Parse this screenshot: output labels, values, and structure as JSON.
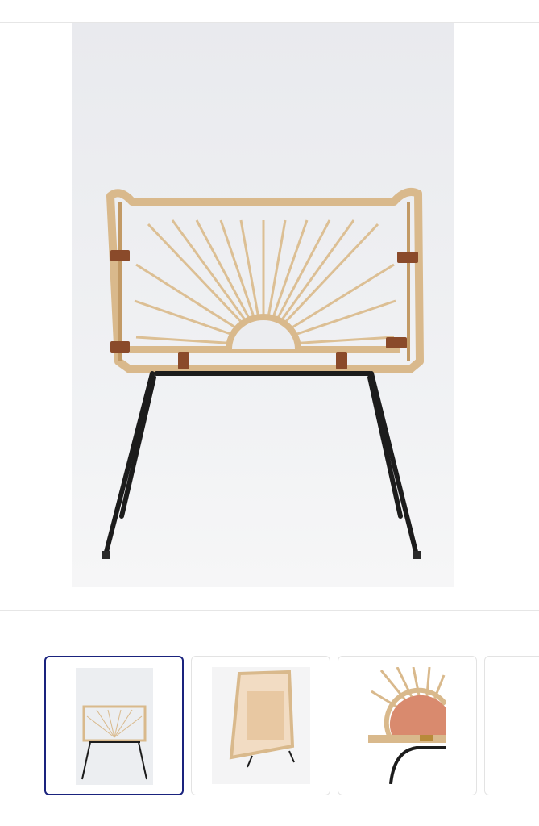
{
  "gallery": {
    "main_image": {
      "subject": "rattan-chair-back-view",
      "selected_index": 0
    },
    "thumbnails": [
      {
        "index": 0,
        "subject": "chair-back-view",
        "selected": true
      },
      {
        "index": 1,
        "subject": "chair-top-view",
        "selected": false
      },
      {
        "index": 2,
        "subject": "sunburst-detail",
        "selected": false
      },
      {
        "index": 3,
        "subject": "more-image",
        "selected": false
      }
    ]
  },
  "colors": {
    "rattan": "#d9b98c",
    "rattan_dark": "#c29a66",
    "leather": "#8a4a2a",
    "metal": "#1c1c1c",
    "selection_border": "#1a237e",
    "backdrop": "#ecedf0"
  }
}
